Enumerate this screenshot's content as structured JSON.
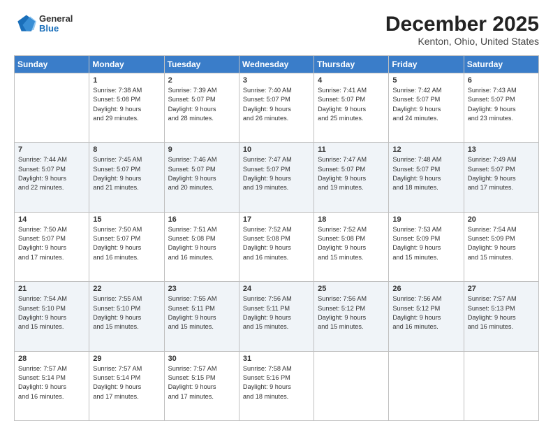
{
  "header": {
    "logo": {
      "general": "General",
      "blue": "Blue"
    },
    "title": "December 2025",
    "location": "Kenton, Ohio, United States"
  },
  "calendar": {
    "weekdays": [
      "Sunday",
      "Monday",
      "Tuesday",
      "Wednesday",
      "Thursday",
      "Friday",
      "Saturday"
    ],
    "rows": [
      [
        {
          "day": "",
          "info": ""
        },
        {
          "day": "1",
          "info": "Sunrise: 7:38 AM\nSunset: 5:08 PM\nDaylight: 9 hours\nand 29 minutes."
        },
        {
          "day": "2",
          "info": "Sunrise: 7:39 AM\nSunset: 5:07 PM\nDaylight: 9 hours\nand 28 minutes."
        },
        {
          "day": "3",
          "info": "Sunrise: 7:40 AM\nSunset: 5:07 PM\nDaylight: 9 hours\nand 26 minutes."
        },
        {
          "day": "4",
          "info": "Sunrise: 7:41 AM\nSunset: 5:07 PM\nDaylight: 9 hours\nand 25 minutes."
        },
        {
          "day": "5",
          "info": "Sunrise: 7:42 AM\nSunset: 5:07 PM\nDaylight: 9 hours\nand 24 minutes."
        },
        {
          "day": "6",
          "info": "Sunrise: 7:43 AM\nSunset: 5:07 PM\nDaylight: 9 hours\nand 23 minutes."
        }
      ],
      [
        {
          "day": "7",
          "info": "Sunrise: 7:44 AM\nSunset: 5:07 PM\nDaylight: 9 hours\nand 22 minutes."
        },
        {
          "day": "8",
          "info": "Sunrise: 7:45 AM\nSunset: 5:07 PM\nDaylight: 9 hours\nand 21 minutes."
        },
        {
          "day": "9",
          "info": "Sunrise: 7:46 AM\nSunset: 5:07 PM\nDaylight: 9 hours\nand 20 minutes."
        },
        {
          "day": "10",
          "info": "Sunrise: 7:47 AM\nSunset: 5:07 PM\nDaylight: 9 hours\nand 19 minutes."
        },
        {
          "day": "11",
          "info": "Sunrise: 7:47 AM\nSunset: 5:07 PM\nDaylight: 9 hours\nand 19 minutes."
        },
        {
          "day": "12",
          "info": "Sunrise: 7:48 AM\nSunset: 5:07 PM\nDaylight: 9 hours\nand 18 minutes."
        },
        {
          "day": "13",
          "info": "Sunrise: 7:49 AM\nSunset: 5:07 PM\nDaylight: 9 hours\nand 17 minutes."
        }
      ],
      [
        {
          "day": "14",
          "info": "Sunrise: 7:50 AM\nSunset: 5:07 PM\nDaylight: 9 hours\nand 17 minutes."
        },
        {
          "day": "15",
          "info": "Sunrise: 7:50 AM\nSunset: 5:07 PM\nDaylight: 9 hours\nand 16 minutes."
        },
        {
          "day": "16",
          "info": "Sunrise: 7:51 AM\nSunset: 5:08 PM\nDaylight: 9 hours\nand 16 minutes."
        },
        {
          "day": "17",
          "info": "Sunrise: 7:52 AM\nSunset: 5:08 PM\nDaylight: 9 hours\nand 16 minutes."
        },
        {
          "day": "18",
          "info": "Sunrise: 7:52 AM\nSunset: 5:08 PM\nDaylight: 9 hours\nand 15 minutes."
        },
        {
          "day": "19",
          "info": "Sunrise: 7:53 AM\nSunset: 5:09 PM\nDaylight: 9 hours\nand 15 minutes."
        },
        {
          "day": "20",
          "info": "Sunrise: 7:54 AM\nSunset: 5:09 PM\nDaylight: 9 hours\nand 15 minutes."
        }
      ],
      [
        {
          "day": "21",
          "info": "Sunrise: 7:54 AM\nSunset: 5:10 PM\nDaylight: 9 hours\nand 15 minutes."
        },
        {
          "day": "22",
          "info": "Sunrise: 7:55 AM\nSunset: 5:10 PM\nDaylight: 9 hours\nand 15 minutes."
        },
        {
          "day": "23",
          "info": "Sunrise: 7:55 AM\nSunset: 5:11 PM\nDaylight: 9 hours\nand 15 minutes."
        },
        {
          "day": "24",
          "info": "Sunrise: 7:56 AM\nSunset: 5:11 PM\nDaylight: 9 hours\nand 15 minutes."
        },
        {
          "day": "25",
          "info": "Sunrise: 7:56 AM\nSunset: 5:12 PM\nDaylight: 9 hours\nand 15 minutes."
        },
        {
          "day": "26",
          "info": "Sunrise: 7:56 AM\nSunset: 5:12 PM\nDaylight: 9 hours\nand 16 minutes."
        },
        {
          "day": "27",
          "info": "Sunrise: 7:57 AM\nSunset: 5:13 PM\nDaylight: 9 hours\nand 16 minutes."
        }
      ],
      [
        {
          "day": "28",
          "info": "Sunrise: 7:57 AM\nSunset: 5:14 PM\nDaylight: 9 hours\nand 16 minutes."
        },
        {
          "day": "29",
          "info": "Sunrise: 7:57 AM\nSunset: 5:14 PM\nDaylight: 9 hours\nand 17 minutes."
        },
        {
          "day": "30",
          "info": "Sunrise: 7:57 AM\nSunset: 5:15 PM\nDaylight: 9 hours\nand 17 minutes."
        },
        {
          "day": "31",
          "info": "Sunrise: 7:58 AM\nSunset: 5:16 PM\nDaylight: 9 hours\nand 18 minutes."
        },
        {
          "day": "",
          "info": ""
        },
        {
          "day": "",
          "info": ""
        },
        {
          "day": "",
          "info": ""
        }
      ]
    ]
  }
}
